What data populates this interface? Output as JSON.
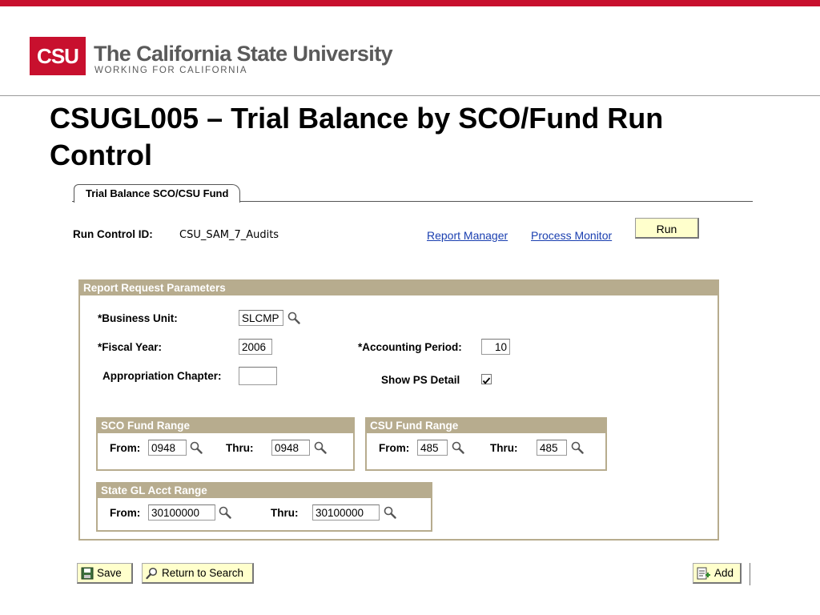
{
  "brand": {
    "logo_text": "CSU",
    "title": "The California State University",
    "subtitle": "WORKING FOR CALIFORNIA",
    "accent_color": "#c8102e"
  },
  "slide_title": "CSUGL005 – Trial Balance by SCO/Fund Run Control",
  "tab": {
    "label": "Trial Balance SCO/CSU Fund"
  },
  "run_control": {
    "label": "Run Control ID:",
    "value": "CSU_SAM_7_Audits",
    "report_manager_link": "Report Manager",
    "process_monitor_link": "Process Monitor",
    "run_button": "Run"
  },
  "parameters": {
    "header": "Report Request Parameters",
    "business_unit": {
      "label": "*Business Unit:",
      "value": "SLCMP"
    },
    "fiscal_year": {
      "label": "*Fiscal Year:",
      "value": "2006"
    },
    "accounting_period": {
      "label": "*Accounting Period:",
      "value": "10"
    },
    "appropriation_chapter": {
      "label": "Appropriation Chapter:",
      "value": ""
    },
    "show_ps_detail": {
      "label": "Show PS Detail",
      "checked": true
    }
  },
  "sco_fund_range": {
    "header": "SCO Fund Range",
    "from_label": "From:",
    "from_value": "0948",
    "thru_label": "Thru:",
    "thru_value": "0948"
  },
  "csu_fund_range": {
    "header": "CSU Fund Range",
    "from_label": "From:",
    "from_value": "485",
    "thru_label": "Thru:",
    "thru_value": "485"
  },
  "state_gl_range": {
    "header": "State GL Acct Range",
    "from_label": "From:",
    "from_value": "30100000",
    "thru_label": "Thru:",
    "thru_value": "30100000"
  },
  "toolbar": {
    "save_label": "Save",
    "return_label": "Return to Search",
    "add_label": "Add"
  },
  "icons": {
    "lookup": "magnifier-icon",
    "save": "floppy-disk-icon",
    "return": "search-return-icon",
    "add": "add-document-icon"
  }
}
